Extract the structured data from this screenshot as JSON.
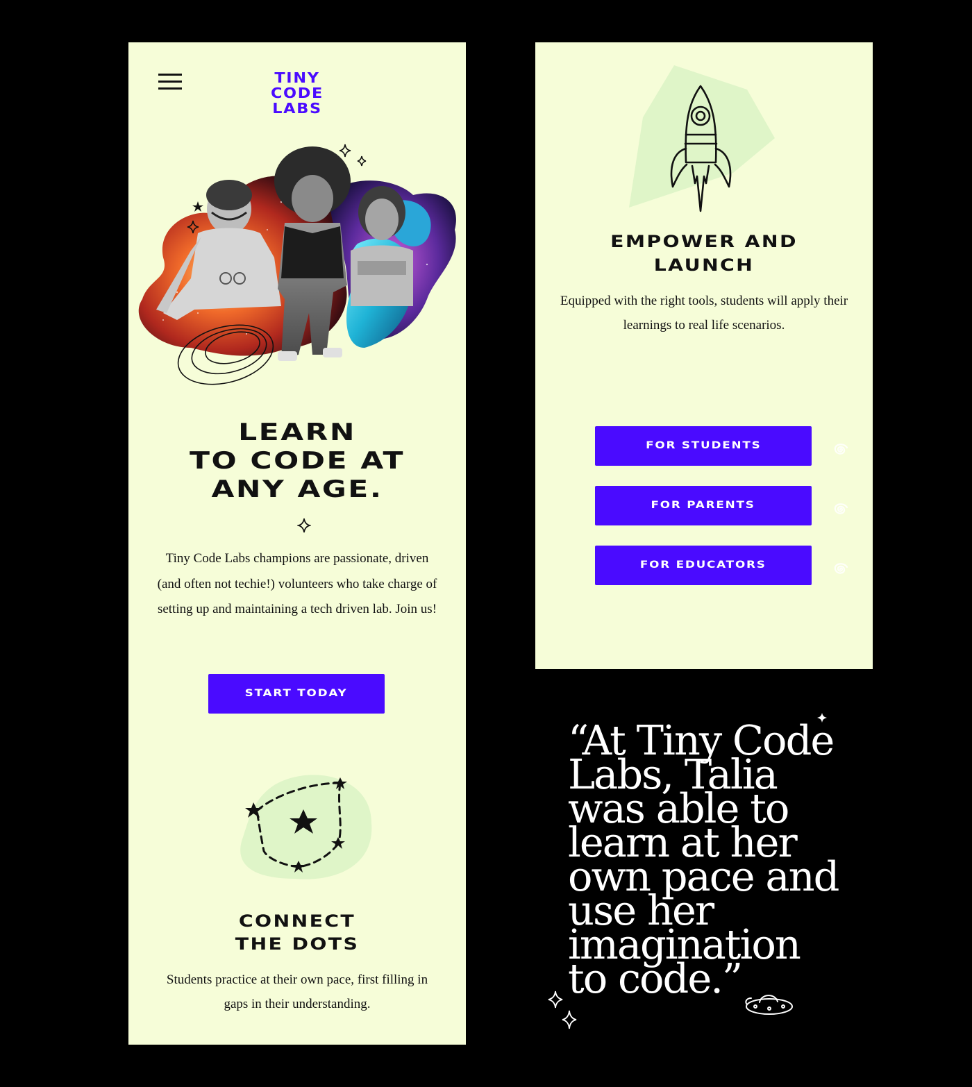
{
  "brand": {
    "logo_lines": [
      "TINY",
      "CODE",
      "LABS"
    ],
    "accent": "#4a0bff",
    "panel_bg": "#f6fdd8",
    "blob_green": "#dff5c8"
  },
  "header": {
    "menu_icon": "hamburger-icon"
  },
  "hero": {
    "title_lines": [
      "LEARN",
      "TO CODE AT",
      "ANY AGE."
    ],
    "body": "Tiny Code Labs champions are passionate, driven (and often not techie!) volunteers who take charge of setting up and maintaining a tech driven lab. Join us!",
    "cta_label": "START TODAY",
    "illustration": "collage of three children over space nebula"
  },
  "connect": {
    "icon": "constellation-icon",
    "title_lines": [
      "CONNECT",
      "THE DOTS"
    ],
    "body": "Students practice at their own pace, first filling in gaps in their understanding."
  },
  "empower": {
    "icon": "rocket-icon",
    "title_lines": [
      "EMPOWER AND",
      "LAUNCH"
    ],
    "body": "Equipped with the right tools, students will apply their learnings to real life scenarios."
  },
  "audience_buttons": [
    {
      "label": "FOR STUDENTS"
    },
    {
      "label": "FOR PARENTS"
    },
    {
      "label": "FOR EDUCATORS"
    }
  ],
  "quote": {
    "text": "“At Tiny Code Labs, Talia was able to learn at her own pace and use her imagination to code.”",
    "lines": [
      "“At Tiny Code",
      "Labs, Talia",
      "was able to",
      "learn at her",
      "own pace and",
      "use her",
      "imagination",
      "to code.”"
    ],
    "icons": [
      "sparkle-icon",
      "ufo-icon"
    ]
  }
}
